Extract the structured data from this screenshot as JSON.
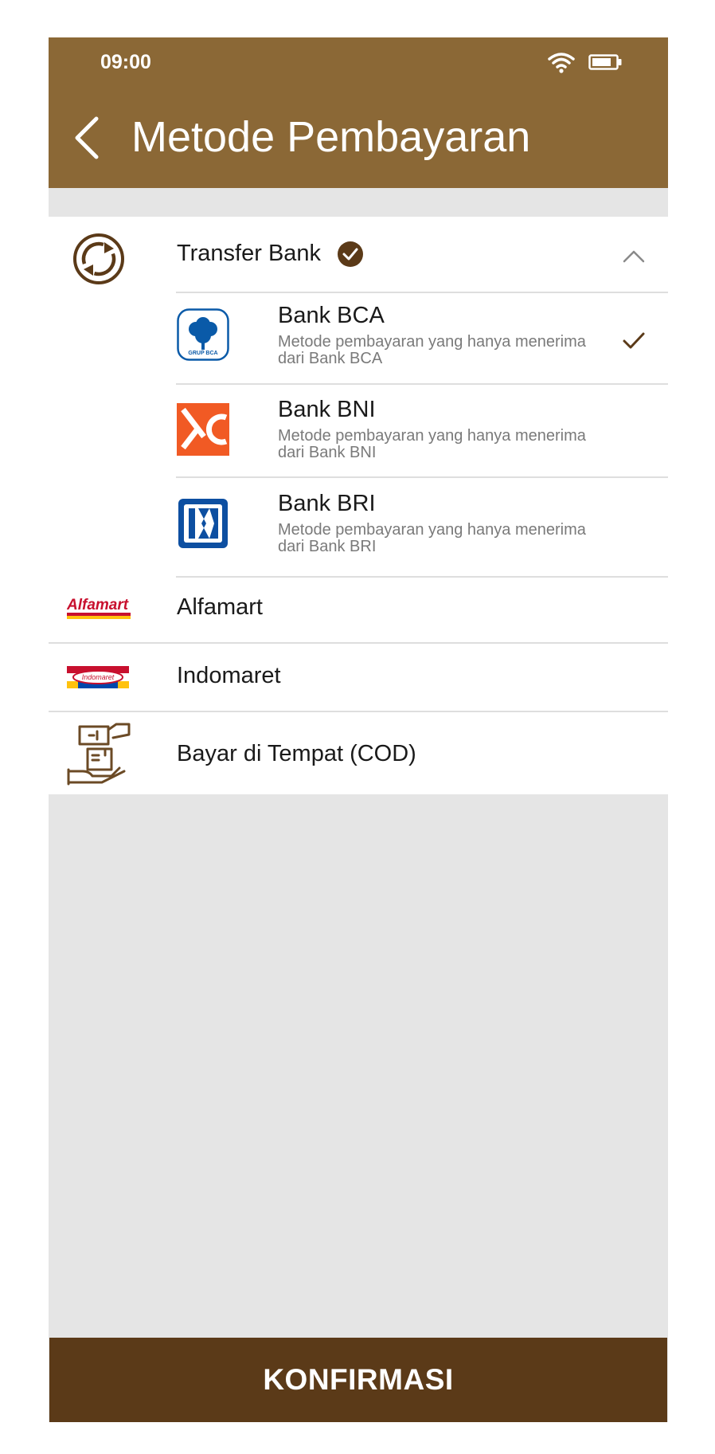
{
  "status_bar": {
    "time": "09:00"
  },
  "header": {
    "title": "Metode Pembayaran"
  },
  "transfer_bank": {
    "label": "Transfer Bank",
    "banks": [
      {
        "name": "Bank BCA",
        "desc_line1": "Metode pembayaran yang hanya menerima",
        "desc_line2": "dari Bank BCA",
        "logo_text": "GRUP BCA",
        "selected": true
      },
      {
        "name": "Bank BNI",
        "desc_line1": "Metode pembayaran yang hanya menerima",
        "desc_line2": "dari Bank BNI",
        "selected": false
      },
      {
        "name": "Bank BRI",
        "desc_line1": "Metode pembayaran yang hanya menerima",
        "desc_line2": "dari Bank BRI",
        "selected": false
      }
    ]
  },
  "methods": [
    {
      "label": "Alfamart",
      "logo_text": "Alfamart"
    },
    {
      "label": "Indomaret",
      "logo_text": "Indomaret"
    },
    {
      "label": "Bayar di Tempat (COD)"
    }
  ],
  "confirm_button": {
    "label": "KONFIRMASI"
  },
  "colors": {
    "header": "#8b6836",
    "button": "#5b3a18",
    "accent": "#5b3a18",
    "background": "#e5e5e5"
  }
}
